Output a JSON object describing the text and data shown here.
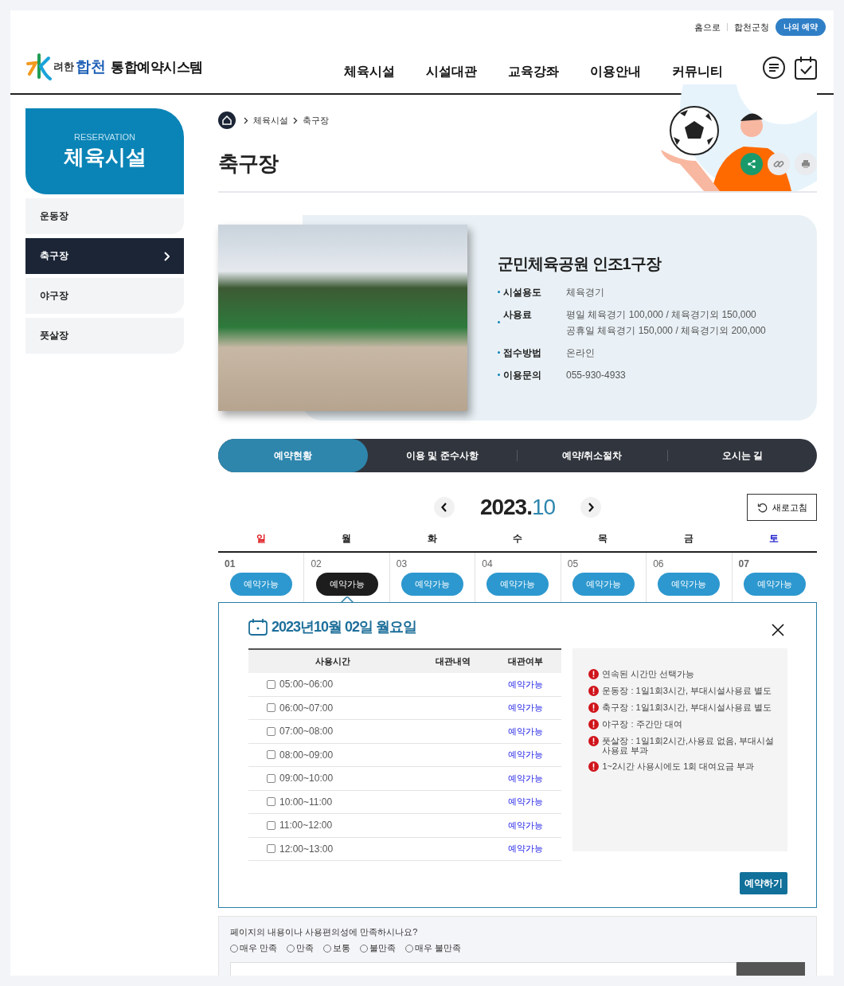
{
  "header": {
    "logo": {
      "tagline": "려한",
      "city": "합천",
      "system": "통합예약시스템"
    },
    "util_links": [
      "홈으로",
      "합천군청"
    ],
    "my_reservation": "나의 예약",
    "nav": [
      "체육시설",
      "시설대관",
      "교육강좌",
      "이용안내",
      "커뮤니티"
    ]
  },
  "sidebar": {
    "subtitle": "RESERVATION",
    "title": "체육시설",
    "items": [
      {
        "label": "운동장",
        "selected": false
      },
      {
        "label": "축구장",
        "selected": true
      },
      {
        "label": "야구장",
        "selected": false
      },
      {
        "label": "풋살장",
        "selected": false
      }
    ]
  },
  "breadcrumb": [
    "체육시설",
    "축구장"
  ],
  "page_title": "축구장",
  "facility": {
    "name": "군민체육공원 인조1구장",
    "details": [
      {
        "label": "시설용도",
        "values": [
          "체육경기"
        ]
      },
      {
        "label": "사용료",
        "values": [
          "평일 체육경기 100,000 / 체육경기외 150,000",
          "공휴일 체육경기 150,000 / 체육경기외 200,000"
        ]
      },
      {
        "label": "접수방법",
        "values": [
          "온라인"
        ]
      },
      {
        "label": "이용문의",
        "values": [
          "055-930-4933"
        ]
      }
    ]
  },
  "tabs": [
    {
      "label": "예약현황",
      "selected": true
    },
    {
      "label": "이용 및 준수사항",
      "selected": false
    },
    {
      "label": "예약/취소절차",
      "selected": false
    },
    {
      "label": "오시는 길",
      "selected": false
    }
  ],
  "calendar": {
    "year": "2023.",
    "month": "10",
    "refresh": "새로고침",
    "weekdays": [
      {
        "label": "일",
        "kind": "sun"
      },
      {
        "label": "월",
        "kind": "weekday"
      },
      {
        "label": "화",
        "kind": "weekday"
      },
      {
        "label": "수",
        "kind": "weekday"
      },
      {
        "label": "목",
        "kind": "weekday"
      },
      {
        "label": "금",
        "kind": "weekday"
      },
      {
        "label": "토",
        "kind": "sat"
      }
    ],
    "days": [
      {
        "date": "01",
        "kind": "sun",
        "status": "예약가능",
        "selected": false
      },
      {
        "date": "02",
        "kind": "weekday",
        "status": "예약가능",
        "selected": true
      },
      {
        "date": "03",
        "kind": "weekday",
        "status": "예약가능",
        "selected": false
      },
      {
        "date": "04",
        "kind": "weekday",
        "status": "예약가능",
        "selected": false
      },
      {
        "date": "05",
        "kind": "weekday",
        "status": "예약가능",
        "selected": false
      },
      {
        "date": "06",
        "kind": "weekday",
        "status": "예약가능",
        "selected": false
      },
      {
        "date": "07",
        "kind": "sat",
        "status": "예약가능",
        "selected": false
      }
    ]
  },
  "detail": {
    "date": "2023년10월 02일 월요일",
    "columns": [
      "사용시간",
      "대관내역",
      "대관여부"
    ],
    "slots": [
      {
        "time": "05:00~06:00",
        "checked": false,
        "status": "예약가능"
      },
      {
        "time": "06:00~07:00",
        "checked": false,
        "status": "예약가능"
      },
      {
        "time": "07:00~08:00",
        "checked": false,
        "status": "예약가능"
      },
      {
        "time": "08:00~09:00",
        "checked": false,
        "status": "예약가능"
      },
      {
        "time": "09:00~10:00",
        "checked": false,
        "status": "예약가능"
      },
      {
        "time": "10:00~11:00",
        "checked": false,
        "status": "예약가능"
      },
      {
        "time": "11:00~12:00",
        "checked": false,
        "status": "예약가능"
      },
      {
        "time": "12:00~13:00",
        "checked": false,
        "status": "예약가능"
      }
    ],
    "notices": [
      "연속된 시간만 선택가능",
      "운동장 : 1일1회3시간, 부대시설사용료 별도",
      "축구장 : 1일1회3시간, 부대시설사용료 별도",
      "야구장 : 주간만 대여",
      "풋살장 : 1일1회2시간,사용료 없음, 부대시설 사용료 부과",
      "1~2시간 사용시에도 1회 대여요금 부과"
    ],
    "submit": "예약하기"
  },
  "survey": {
    "question": "페이지의 내용이나 사용편의성에 만족하시나요?",
    "options": [
      {
        "label": "매우 만족",
        "selected": false
      },
      {
        "label": "만족",
        "selected": false
      },
      {
        "label": "보통",
        "selected": false
      },
      {
        "label": "불만족",
        "selected": false
      },
      {
        "label": "매우 불만족",
        "selected": false
      }
    ]
  }
}
